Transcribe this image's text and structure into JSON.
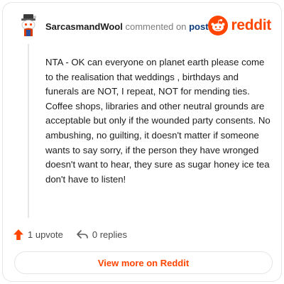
{
  "header": {
    "username": "SarcasmandWool",
    "action_text": "commented on",
    "post_link": "post",
    "brand": "reddit"
  },
  "comment": {
    "text": "NTA - OK can everyone on planet earth please come to the realisation that weddings , birthdays and funerals are NOT, I repeat, NOT for mending ties. Coffee shops, libraries and other neutral grounds are acceptable but only if the wounded party consents. No ambushing, no guilting, it doesn't matter if someone wants to say sorry, if the person they have wronged doesn't want to hear, they sure as sugar honey ice tea don't have to listen!"
  },
  "actions": {
    "upvotes": "1 upvote",
    "replies": "0 replies"
  },
  "footer": {
    "view_more": "View more on Reddit"
  },
  "colors": {
    "accent": "#ff4500",
    "link": "#0f3a7a",
    "border": "#e4e6e8"
  },
  "icons": [
    "reddit-avatar-icon",
    "reddit-logo-icon",
    "upvote-arrow-icon",
    "reply-icon"
  ]
}
